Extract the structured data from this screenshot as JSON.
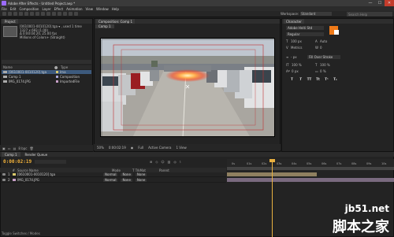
{
  "window": {
    "title": "Adobe After Effects - Untitled Project.aep *",
    "controls": [
      "—",
      "☐",
      "✕"
    ]
  },
  "menu": [
    "File",
    "Edit",
    "Composition",
    "Layer",
    "Effect",
    "Animation",
    "View",
    "Window",
    "Help"
  ],
  "toolbar": {
    "workspace_label": "Workspace:",
    "workspace_value": "Standard",
    "search_placeholder": "Search Help"
  },
  "project": {
    "tab": "Project",
    "selected_name": "[0610001-0010120].tga ▾ , used 1 time",
    "info_lines": [
      "1327 x 693 (1.00)",
      "Δ 0:00:04:20, 25.00 fps",
      "Millions of Colors+ (Straight)"
    ],
    "col_name": "Name",
    "col_label": "⬤",
    "col_type": "Type",
    "items": [
      {
        "name": "[0610001-0010120].tga",
        "type": "Ima",
        "color": "#d9c96a",
        "selected": true
      },
      {
        "name": "Comp 1",
        "type": "Composition",
        "color": "#a8a8d8",
        "selected": false
      },
      {
        "name": "IMG_0174.JPG",
        "type": "ImportedFile",
        "color": "#c8a0c8",
        "selected": false
      }
    ],
    "footer_bpc": "8 bpc"
  },
  "viewer": {
    "tab": "Composition: Comp 1",
    "breadcrumb": "Comp 1",
    "zoom": "50%",
    "time": "0:00:02:19",
    "resolution": "Full",
    "camera": "Active Camera",
    "views": "1 View"
  },
  "character": {
    "tab": "Character",
    "font": "Adobe Heiti Std",
    "style": "Regular",
    "size": "100 px",
    "leading": "Auto",
    "kerning": "Metrics",
    "tracking": "0",
    "stroke": "- px",
    "stroke_type": "Fill Over Stroke",
    "vscale": "100 %",
    "hscale": "100 %",
    "baseline": "0 px",
    "tsume": "0 %",
    "fill_color": "#f07a18",
    "format_buttons": [
      "T",
      "T",
      "TT",
      "Tt",
      "T¹",
      "T₁"
    ]
  },
  "timeline": {
    "tabs": [
      "Comp 1",
      "Render Queue"
    ],
    "timecode": "0:00:02:19",
    "headers": [
      "#",
      "Source Name",
      "Mode",
      "T TrkMat",
      "Parent"
    ],
    "layers": [
      {
        "num": "1",
        "name": "[0610001-0010120].tga",
        "mode": "Normal",
        "trkmat": "None",
        "parent": "None"
      },
      {
        "num": "2",
        "name": "IMG_0174.JPG",
        "mode": "Normal",
        "trkmat": "None",
        "parent": "None"
      }
    ],
    "ruler_ticks": [
      "0s",
      "01s",
      "02s",
      "03s",
      "04s",
      "05s",
      "06s",
      "07s",
      "08s",
      "09s",
      "10s"
    ],
    "footer_label": "Toggle Switches / Modes"
  },
  "watermark": {
    "line1": "jb51.net",
    "line2": "脚本之家"
  }
}
